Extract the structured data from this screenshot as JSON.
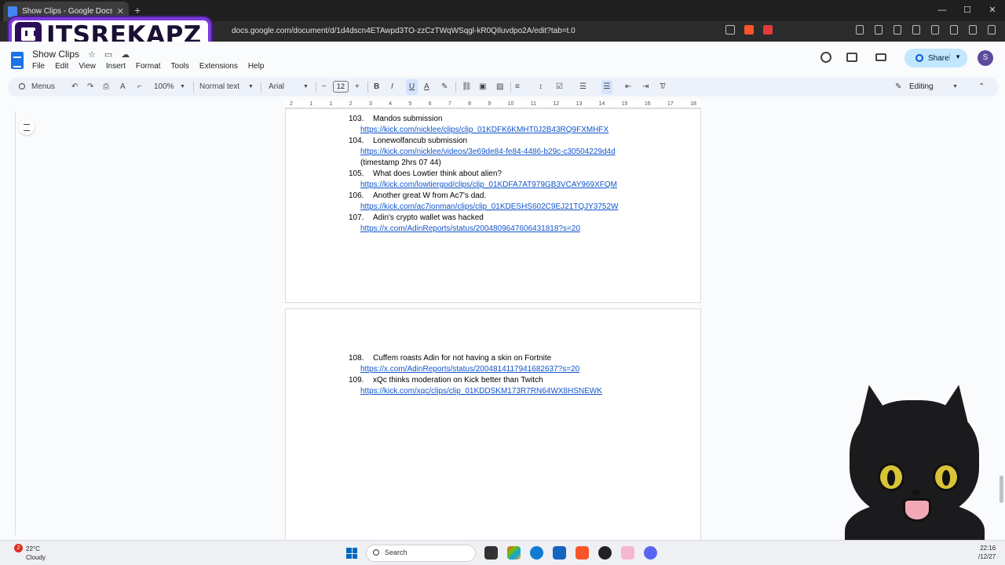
{
  "browser": {
    "tab_title": "Show Clips - Google Docs",
    "url": "docs.google.com/document/d/1d4dscn4ETAwpd3TO-zzCzTWqWSqgl-kR0QIluvdpo2A/edit?tab=t.0"
  },
  "overlay": {
    "channel_name": "ITSREKAPZ"
  },
  "docs": {
    "title": "Show Clips",
    "menus": [
      "File",
      "Edit",
      "View",
      "Insert",
      "Format",
      "Tools",
      "Extensions",
      "Help"
    ],
    "share_label": "Share",
    "avatar_initial": "S"
  },
  "toolbar": {
    "search_menus": "Menus",
    "zoom": "100%",
    "style": "Normal text",
    "font": "Arial",
    "font_size": "12",
    "mode": "Editing"
  },
  "ruler": {
    "ticks": [
      "2",
      "1",
      "1",
      "2",
      "3",
      "4",
      "5",
      "6",
      "7",
      "8",
      "9",
      "10",
      "11",
      "12",
      "13",
      "14",
      "15",
      "16",
      "17",
      "18"
    ]
  },
  "document": {
    "page1_entries": [
      {
        "num": "103.",
        "title": "Mandos submission",
        "link": "https://kick.com/nicklee/clips/clip_01KDFK6KMHT0J2B43RQ9FXMHFX",
        "note": ""
      },
      {
        "num": "104.",
        "title": "Lonewolfancub submission",
        "link": "https://kick.com/nicklee/videos/3e69de84-fe84-4486-b29c-c30504229d4d",
        "note": "(timestamp 2hrs 07 44)"
      },
      {
        "num": "105.",
        "title": "What does Lowtier think about alien?",
        "link": "https://kick.com/lowtiergod/clips/clip_01KDFA7AT979GB3VCAY969XFQM",
        "note": ""
      },
      {
        "num": "106.",
        "title": "Another great W from Ac7's dad.",
        "link": "https://kick.com/ac7ionman/clips/clip_01KDESHS602C9EJ21TQJY3752W",
        "note": ""
      },
      {
        "num": "107.",
        "title": "Adin's crypto wallet was hacked",
        "link": "https://x.com/AdinReports/status/2004809647606431818?s=20",
        "note": ""
      }
    ],
    "page2_entries": [
      {
        "num": "108.",
        "title": "Cuffem roasts Adin for not having a skin on Fortnite",
        "link": "https://x.com/AdinReports/status/2004814117941682637?s=20",
        "note": ""
      },
      {
        "num": "109.",
        "title": "xQc thinks moderation on Kick better than Twitch",
        "link": "https://kick.com/xqc/clips/clip_01KDDSKM173R7RN64WX8HSNEWK",
        "note": ""
      }
    ]
  },
  "taskbar": {
    "weather_badge": "2",
    "temperature": "22°C",
    "weather": "Cloudy",
    "search_label": "Search",
    "time": "22:16",
    "date": "/12/27"
  },
  "colors": {
    "link": "#1155cc",
    "share_bg": "#c2e7ff",
    "twitch_purple": "#7a3bd8"
  }
}
